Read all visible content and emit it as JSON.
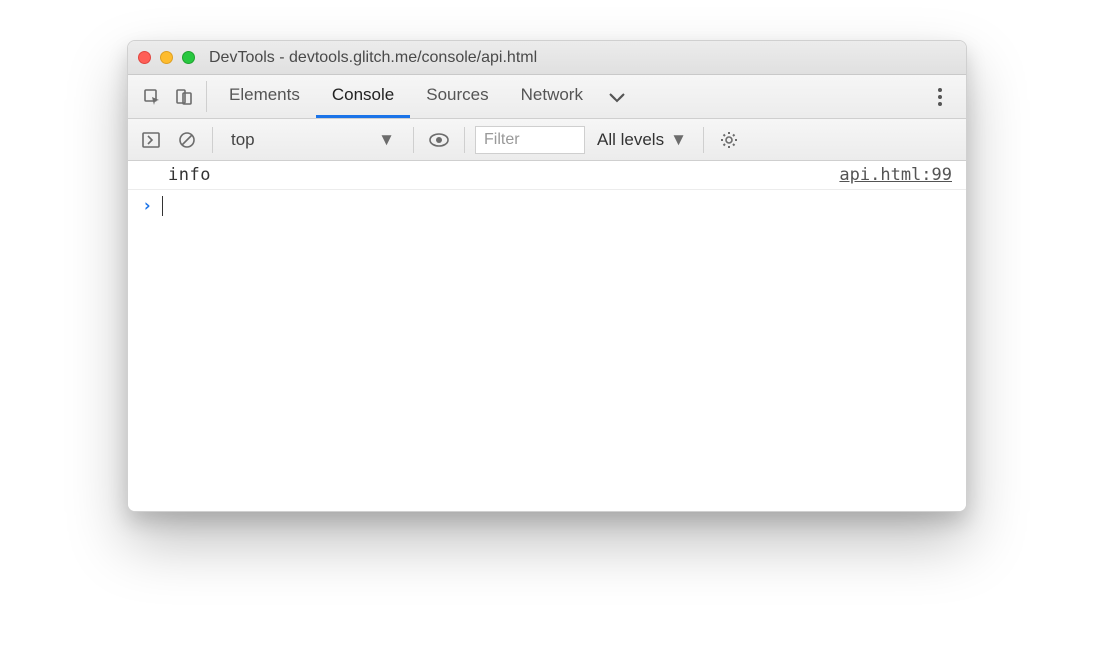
{
  "window": {
    "title": "DevTools - devtools.glitch.me/console/api.html"
  },
  "tabs": {
    "items": [
      "Elements",
      "Console",
      "Sources",
      "Network"
    ],
    "active": "Console"
  },
  "toolbar": {
    "context": "top",
    "filter_placeholder": "Filter",
    "levels_label": "All levels"
  },
  "console": {
    "logs": [
      {
        "text": "info",
        "source": "api.html:99"
      }
    ]
  }
}
